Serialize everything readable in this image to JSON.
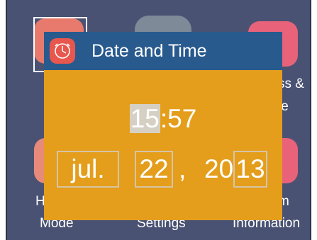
{
  "background": {
    "labels": {
      "left_line1": "H",
      "left_line2": "Mode",
      "center_line2": "Settings",
      "right_top_line1": "ss &",
      "right_top_line2": "le",
      "right_bottom_line1": "m",
      "right_bottom_line2": "Information"
    },
    "icons": [
      "home-mode-icon",
      "settings-icon",
      "access-icon",
      "language-icon",
      "system-info-icon"
    ]
  },
  "dialog": {
    "title": "Date and Time",
    "icon": "clock-icon",
    "time": {
      "hour": "15",
      "separator": ":",
      "minute": "57"
    },
    "date": {
      "month": "jul.",
      "day": "22",
      "comma": ",",
      "year_prefix": "20",
      "year_suffix": "13"
    }
  },
  "colors": {
    "dialog_body": "#e49e1c",
    "dialog_header": "#285a8e",
    "screen_bg": "#4a5273"
  }
}
